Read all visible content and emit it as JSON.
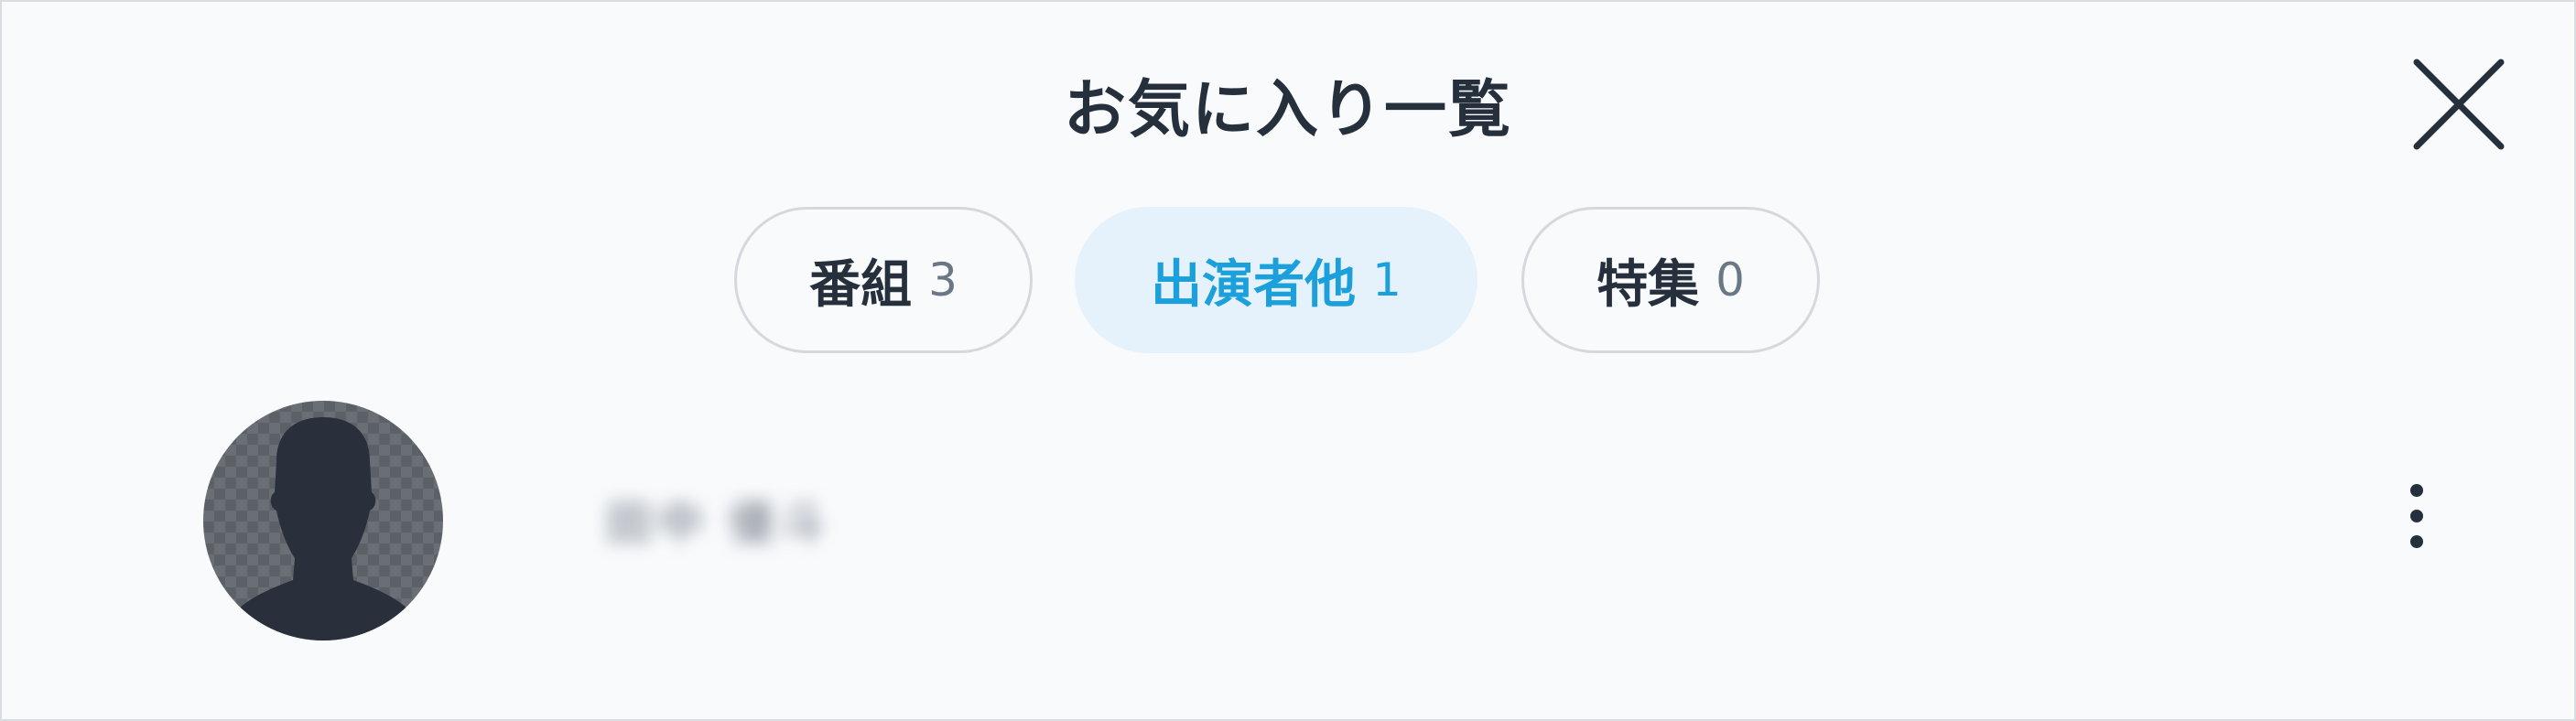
{
  "dialog": {
    "title": "お気に入り一覧"
  },
  "tabs": [
    {
      "label": "番組",
      "count": "3",
      "active": false
    },
    {
      "label": "出演者他",
      "count": "1",
      "active": true
    },
    {
      "label": "特集",
      "count": "0",
      "active": false
    }
  ],
  "list": {
    "items": [
      {
        "name": "田中 優斗",
        "avatar_icon": "person-placeholder-icon"
      }
    ]
  },
  "colors": {
    "accent": "#1ba0db",
    "active_tab_bg": "#e6f2fb",
    "text_dark": "#26303d",
    "count_gray": "#6b7785",
    "avatar_silhouette": "#2a303b",
    "panel_bg": "#f8fafc"
  }
}
